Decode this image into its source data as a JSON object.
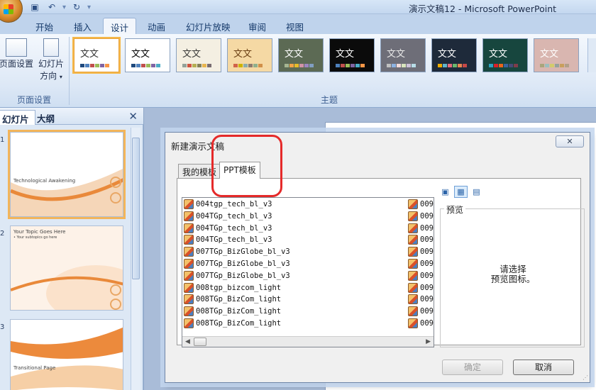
{
  "window": {
    "title": "演示文稿12 - Microsoft PowerPoint"
  },
  "ribbon": {
    "tabs": [
      "开始",
      "插入",
      "设计",
      "动画",
      "幻灯片放映",
      "审阅",
      "视图"
    ],
    "active_tab": "设计",
    "page_setup_group": {
      "label": "页面设置",
      "page_setup_button": "页面设置",
      "orientation_button_line1": "幻灯片",
      "orientation_button_line2": "方向"
    },
    "themes_group": {
      "label": "主题",
      "sample_text": "文文",
      "themes": [
        {
          "bg": "#ffffff",
          "fg": "#333333",
          "swatches": [
            "#1f497d",
            "#4f81bd",
            "#c0504d",
            "#9bbb59",
            "#8064a2",
            "#f79646"
          ]
        },
        {
          "bg": "#ffffff",
          "fg": "#000000",
          "swatches": [
            "#1f497d",
            "#4f81bd",
            "#c0504d",
            "#9bbb59",
            "#8064a2",
            "#4bacc6"
          ]
        },
        {
          "bg": "#f4efe2",
          "fg": "#3a3a3a",
          "swatches": [
            "#93a299",
            "#cf543f",
            "#b5ae53",
            "#848058",
            "#e8b54d",
            "#786c71"
          ]
        },
        {
          "bg": "#f5d9a4",
          "fg": "#6a3f14",
          "swatches": [
            "#d16349",
            "#ccb400",
            "#8cadae",
            "#8c7b70",
            "#8fb08c",
            "#d19049"
          ]
        },
        {
          "bg": "#5c6a54",
          "fg": "#ffffff",
          "swatches": [
            "#a5b592",
            "#f3a447",
            "#e7bc29",
            "#d092a7",
            "#9c85c0",
            "#809ec2"
          ]
        },
        {
          "bg": "#0b0b0b",
          "fg": "#ffffff",
          "swatches": [
            "#4f81bd",
            "#c0504d",
            "#9bbb59",
            "#8064a2",
            "#4bacc6",
            "#f79646"
          ]
        },
        {
          "bg": "#6e6e78",
          "fg": "#e8e8e8",
          "swatches": [
            "#c0c0c0",
            "#8db3e2",
            "#f2dcdb",
            "#d7e4bc",
            "#ccc1d9",
            "#b7dde8"
          ]
        },
        {
          "bg": "#1e2a3a",
          "fg": "#ffffff",
          "swatches": [
            "#f0ad00",
            "#60b5cc",
            "#e66c7d",
            "#6bb76d",
            "#e88651",
            "#c64847"
          ]
        },
        {
          "bg": "#17463e",
          "fg": "#ffffff",
          "swatches": [
            "#2da2bf",
            "#da1f28",
            "#eb641b",
            "#39639d",
            "#474b78",
            "#7d3c4a"
          ]
        },
        {
          "bg": "#d9b6b0",
          "fg": "#ffffff",
          "swatches": [
            "#a9a57c",
            "#9cbebd",
            "#d2cb6c",
            "#95a39d",
            "#c89f5d",
            "#b1a089"
          ]
        }
      ]
    }
  },
  "slides_pane": {
    "tabs": [
      "幻灯片",
      "大纲"
    ],
    "close_icon": "✕",
    "slides": [
      {
        "number": "1",
        "title": "Technological Awakening",
        "subtitle": ""
      },
      {
        "number": "2",
        "title": "Your Topic Goes Here",
        "subtitle": "• Your subtopics go here"
      },
      {
        "number": "3",
        "title": "Transitional Page",
        "subtitle": ""
      }
    ]
  },
  "dialog": {
    "title": "新建演示文稿",
    "close_label": "✕",
    "tabs": [
      "我的模板",
      "PPT模板"
    ],
    "active_tab": "PPT模板",
    "files_left": [
      "004tgp_tech_bl_v3",
      "004TGp_tech_bl_v3",
      "004TGp_tech_bl_v3",
      "004TGp_tech_bl_v3",
      "007TGp_BizGlobe_bl_v3",
      "007TGp_BizGlobe_bl_v3",
      "007TGp_BizGlobe_bl_v3",
      "008tgp_bizcom_light",
      "008TGp_BizCom_light",
      "008TGp_BizCom_light",
      "008TGp_BizCom_light"
    ],
    "files_right": [
      "009",
      "009",
      "009",
      "009",
      "009",
      "009",
      "009",
      "009",
      "009",
      "009",
      "009"
    ],
    "preview_label": "预览",
    "preview_text_line1": "请选择",
    "preview_text_line2": "预览图标。",
    "ok_button": "确定",
    "cancel_button": "取消"
  },
  "colors": {
    "highlight": "#e52a2a",
    "selection": "#f3b55a",
    "ribbon_text": "#15396a"
  }
}
